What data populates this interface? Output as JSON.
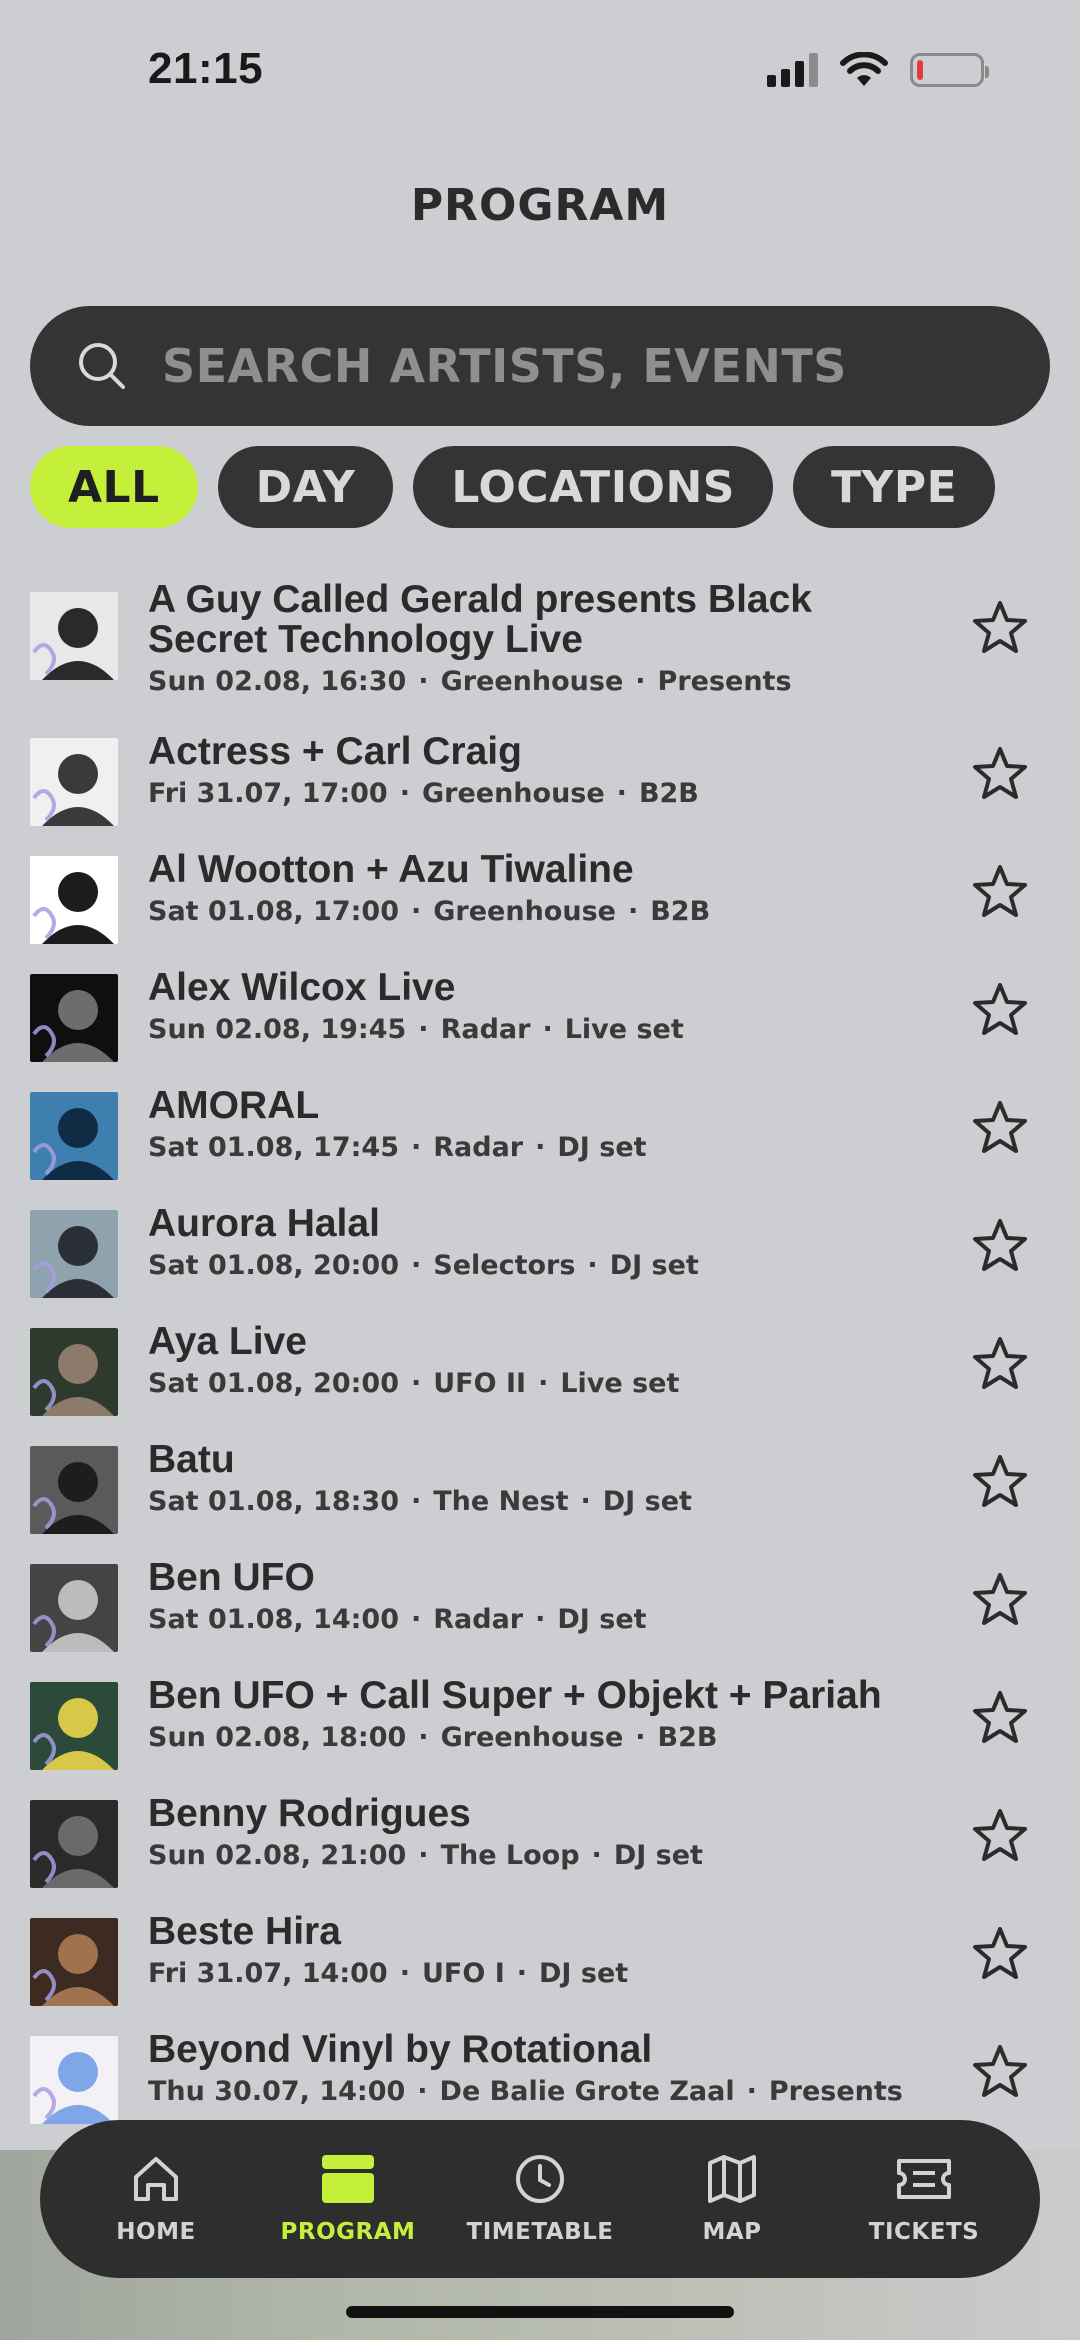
{
  "status_bar": {
    "time": "21:15"
  },
  "header": {
    "title": "PROGRAM"
  },
  "search": {
    "placeholder": "SEARCH ARTISTS, EVENTS"
  },
  "filters": [
    {
      "label": "ALL",
      "active": true
    },
    {
      "label": "DAY",
      "active": false
    },
    {
      "label": "LOCATIONS",
      "active": false
    },
    {
      "label": "TYPE",
      "active": false
    }
  ],
  "events": [
    {
      "title": "A Guy Called Gerald presents Black Secret Technology Live",
      "date": "Sun 02.08, 16:30",
      "location": "Greenhouse",
      "type": "Presents"
    },
    {
      "title": "Actress + Carl Craig",
      "date": "Fri 31.07, 17:00",
      "location": "Greenhouse",
      "type": "B2B"
    },
    {
      "title": "Al Wootton + Azu Tiwaline",
      "date": "Sat 01.08, 17:00",
      "location": "Greenhouse",
      "type": "B2B"
    },
    {
      "title": "Alex Wilcox Live",
      "date": "Sun 02.08, 19:45",
      "location": "Radar",
      "type": "Live set"
    },
    {
      "title": "AMORAL",
      "date": "Sat 01.08, 17:45",
      "location": "Radar",
      "type": "DJ set"
    },
    {
      "title": "Aurora Halal",
      "date": "Sat 01.08, 20:00",
      "location": "Selectors",
      "type": "DJ set"
    },
    {
      "title": "Aya Live",
      "date": "Sat 01.08, 20:00",
      "location": "UFO II",
      "type": "Live set"
    },
    {
      "title": "Batu",
      "date": "Sat 01.08, 18:30",
      "location": "The Nest",
      "type": "DJ set"
    },
    {
      "title": "Ben UFO",
      "date": "Sat 01.08, 14:00",
      "location": "Radar",
      "type": "DJ set"
    },
    {
      "title": "Ben UFO + Call Super + Objekt + Pariah",
      "date": "Sun 02.08, 18:00",
      "location": "Greenhouse",
      "type": "B2B"
    },
    {
      "title": "Benny Rodrigues",
      "date": "Sun 02.08, 21:00",
      "location": "The Loop",
      "type": "DJ set"
    },
    {
      "title": "Beste Hira",
      "date": "Fri 31.07, 14:00",
      "location": "UFO I",
      "type": "DJ set"
    },
    {
      "title": "Beyond Vinyl by Rotational",
      "date": "Thu 30.07, 14:00",
      "location": "De Balie Grote Zaal",
      "type": "Presents"
    }
  ],
  "nav": [
    {
      "label": "HOME",
      "icon": "home-icon",
      "active": false
    },
    {
      "label": "PROGRAM",
      "icon": "program-icon",
      "active": true
    },
    {
      "label": "TIMETABLE",
      "icon": "clock-icon",
      "active": false
    },
    {
      "label": "MAP",
      "icon": "map-icon",
      "active": false
    },
    {
      "label": "TICKETS",
      "icon": "ticket-icon",
      "active": false
    }
  ],
  "colors": {
    "accent": "#c4ef3b",
    "background": "#cdced2",
    "surface": "#343434"
  }
}
